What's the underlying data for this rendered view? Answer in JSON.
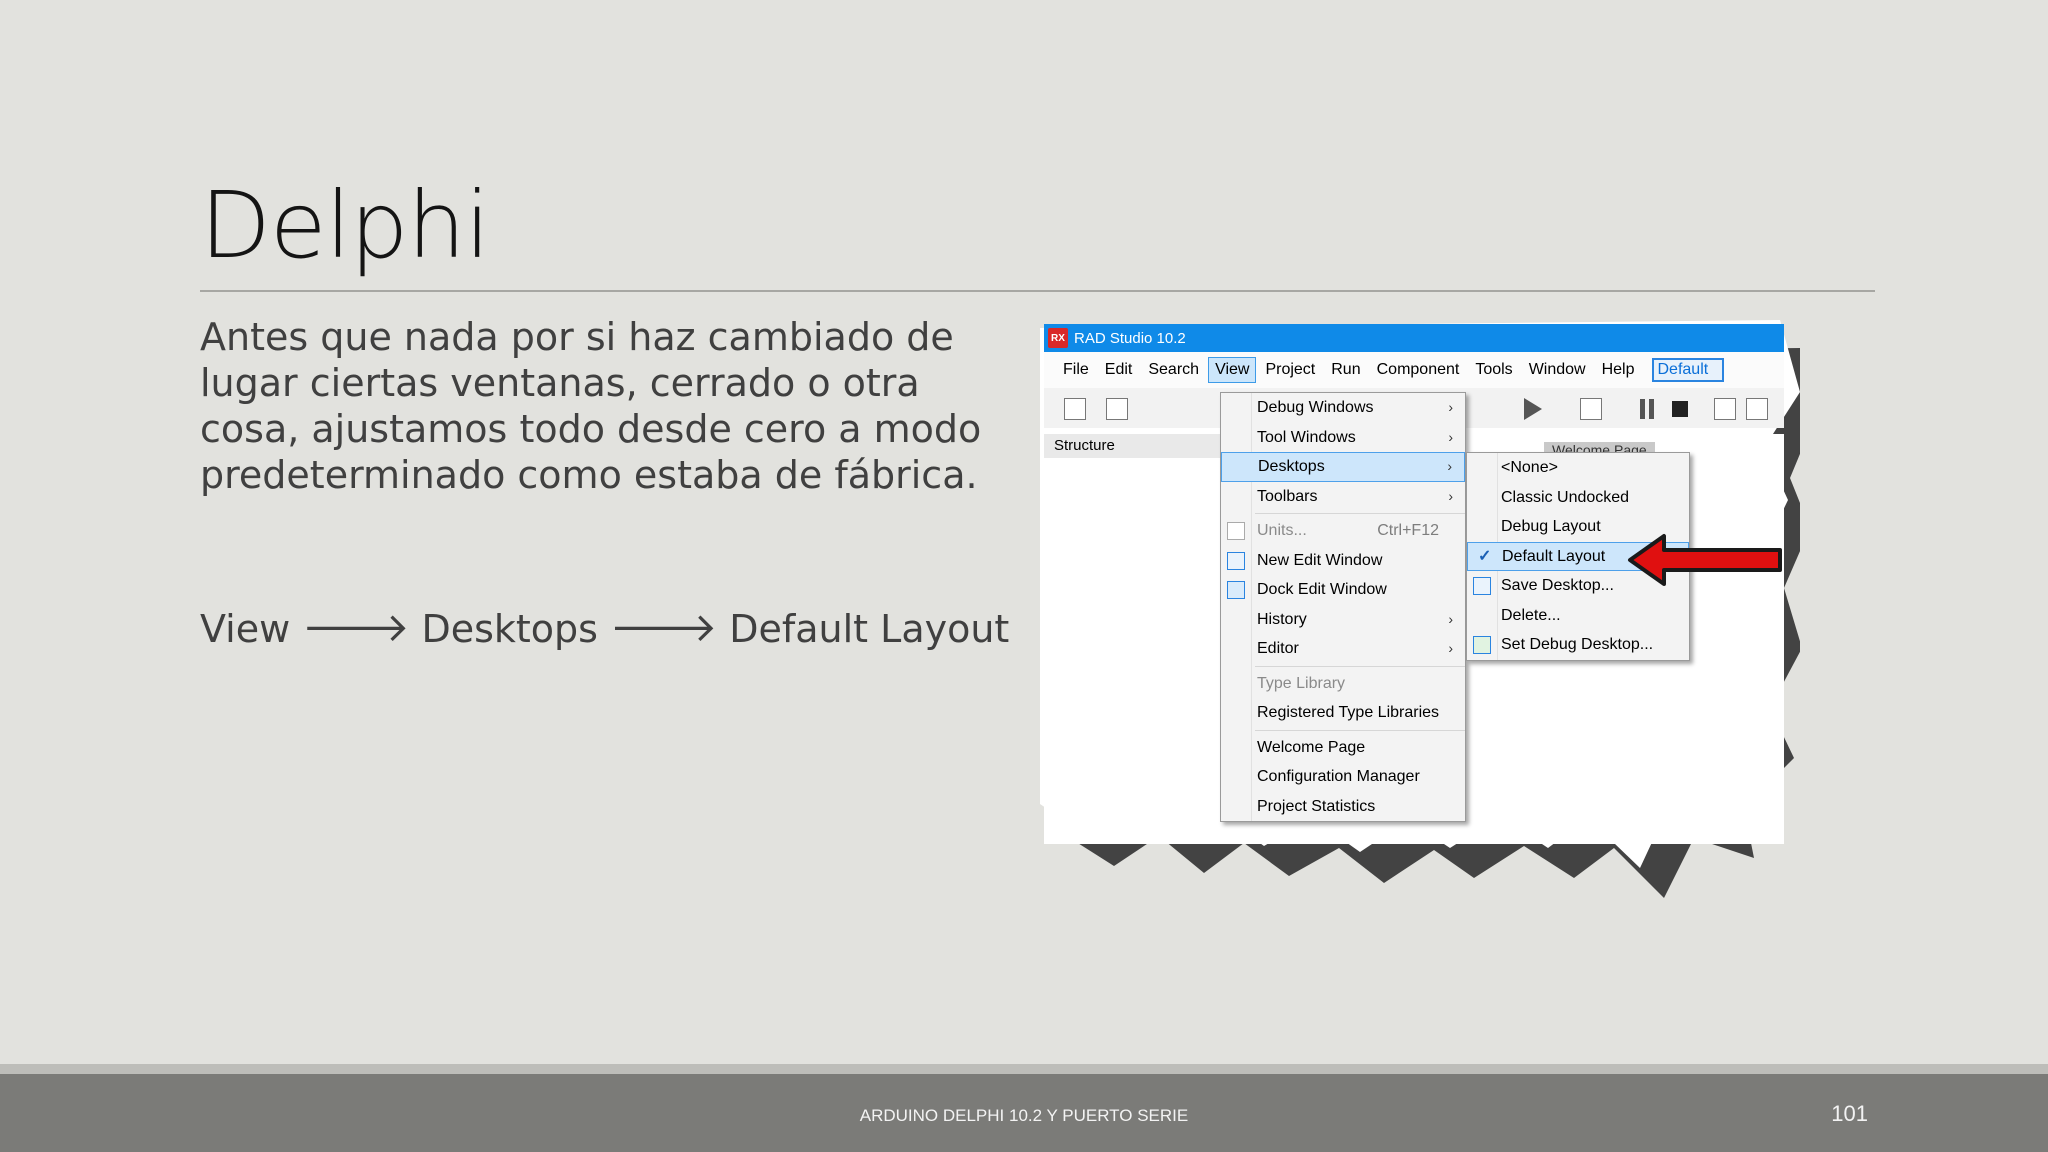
{
  "slide": {
    "title": "Delphi",
    "body": "Antes que nada por si haz cambiado de lugar ciertas ventanas, cerrado o otra cosa, ajustamos todo desde cero a modo predeterminado como estaba de fábrica.",
    "path": {
      "step1": "View",
      "step2": "Desktops",
      "step3": "Default Layout",
      "arrow": "🡒"
    },
    "footer": "ARDUINO DELPHI 10.2 Y PUERTO SERIE",
    "page_number": "101"
  },
  "screenshot": {
    "app_logo": "RX",
    "window_title": "RAD Studio 10.2",
    "menubar": [
      "File",
      "Edit",
      "Search",
      "View",
      "Project",
      "Run",
      "Component",
      "Tools",
      "Window",
      "Help"
    ],
    "layout_combo": "Default",
    "structure_label": "Structure",
    "welcome_tab": "Welcome Page",
    "view_menu": {
      "items": [
        {
          "label": "Debug Windows",
          "sub": "›"
        },
        {
          "label": "Tool Windows",
          "sub": "›"
        },
        {
          "label": "Desktops",
          "sub": "›"
        },
        {
          "label": "Toolbars",
          "sub": "›"
        },
        {
          "label": "Units...",
          "shortcut": "Ctrl+F12"
        },
        {
          "label": "New Edit Window"
        },
        {
          "label": "Dock Edit Window"
        },
        {
          "label": "History",
          "sub": "›"
        },
        {
          "label": "Editor",
          "sub": "›"
        },
        {
          "label": "Type Library"
        },
        {
          "label": "Registered Type Libraries"
        },
        {
          "label": "Welcome Page"
        },
        {
          "label": "Configuration Manager"
        },
        {
          "label": "Project Statistics"
        }
      ]
    },
    "desktops_menu": {
      "items": [
        {
          "label": "<None>"
        },
        {
          "label": "Classic Undocked"
        },
        {
          "label": "Debug Layout"
        },
        {
          "label": "Default Layout",
          "check": "✓"
        },
        {
          "label": "Save Desktop..."
        },
        {
          "label": "Delete..."
        },
        {
          "label": "Set Debug Desktop..."
        }
      ]
    },
    "colors": {
      "titlebar": "#0f8ae8",
      "highlight": "#cde6fb",
      "arrow": "#e01010"
    }
  }
}
